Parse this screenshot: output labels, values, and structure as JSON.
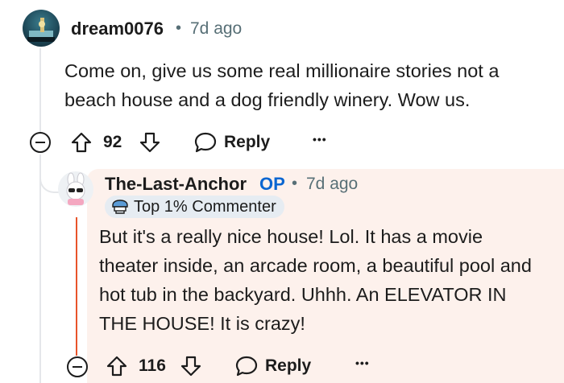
{
  "parent_comment": {
    "username": "dream0076",
    "separator": "•",
    "time": "7d ago",
    "body": "Come on, give us some real millionaire stories not a beach house and a dog friendly winery. Wow us.",
    "votes": "92",
    "reply_label": "Reply",
    "more_label": "•••"
  },
  "reply_comment": {
    "username": "The-Last-Anchor",
    "op_badge": "OP",
    "separator": "•",
    "time": "7d ago",
    "flair": "Top 1% Commenter",
    "body": "But it's a really nice house! Lol. It has a movie theater inside, an arcade room, a beautiful pool and hot tub in the backyard. Uhhh. An ELEVATOR IN THE HOUSE! It is crazy!",
    "votes": "116",
    "reply_label": "Reply",
    "more_label": "•••"
  },
  "colors": {
    "reply_background": "#fdf1ec",
    "op_color": "#0a66d1",
    "thread_line": "#e5e7ea",
    "reply_accent_line": "#e8542a"
  }
}
